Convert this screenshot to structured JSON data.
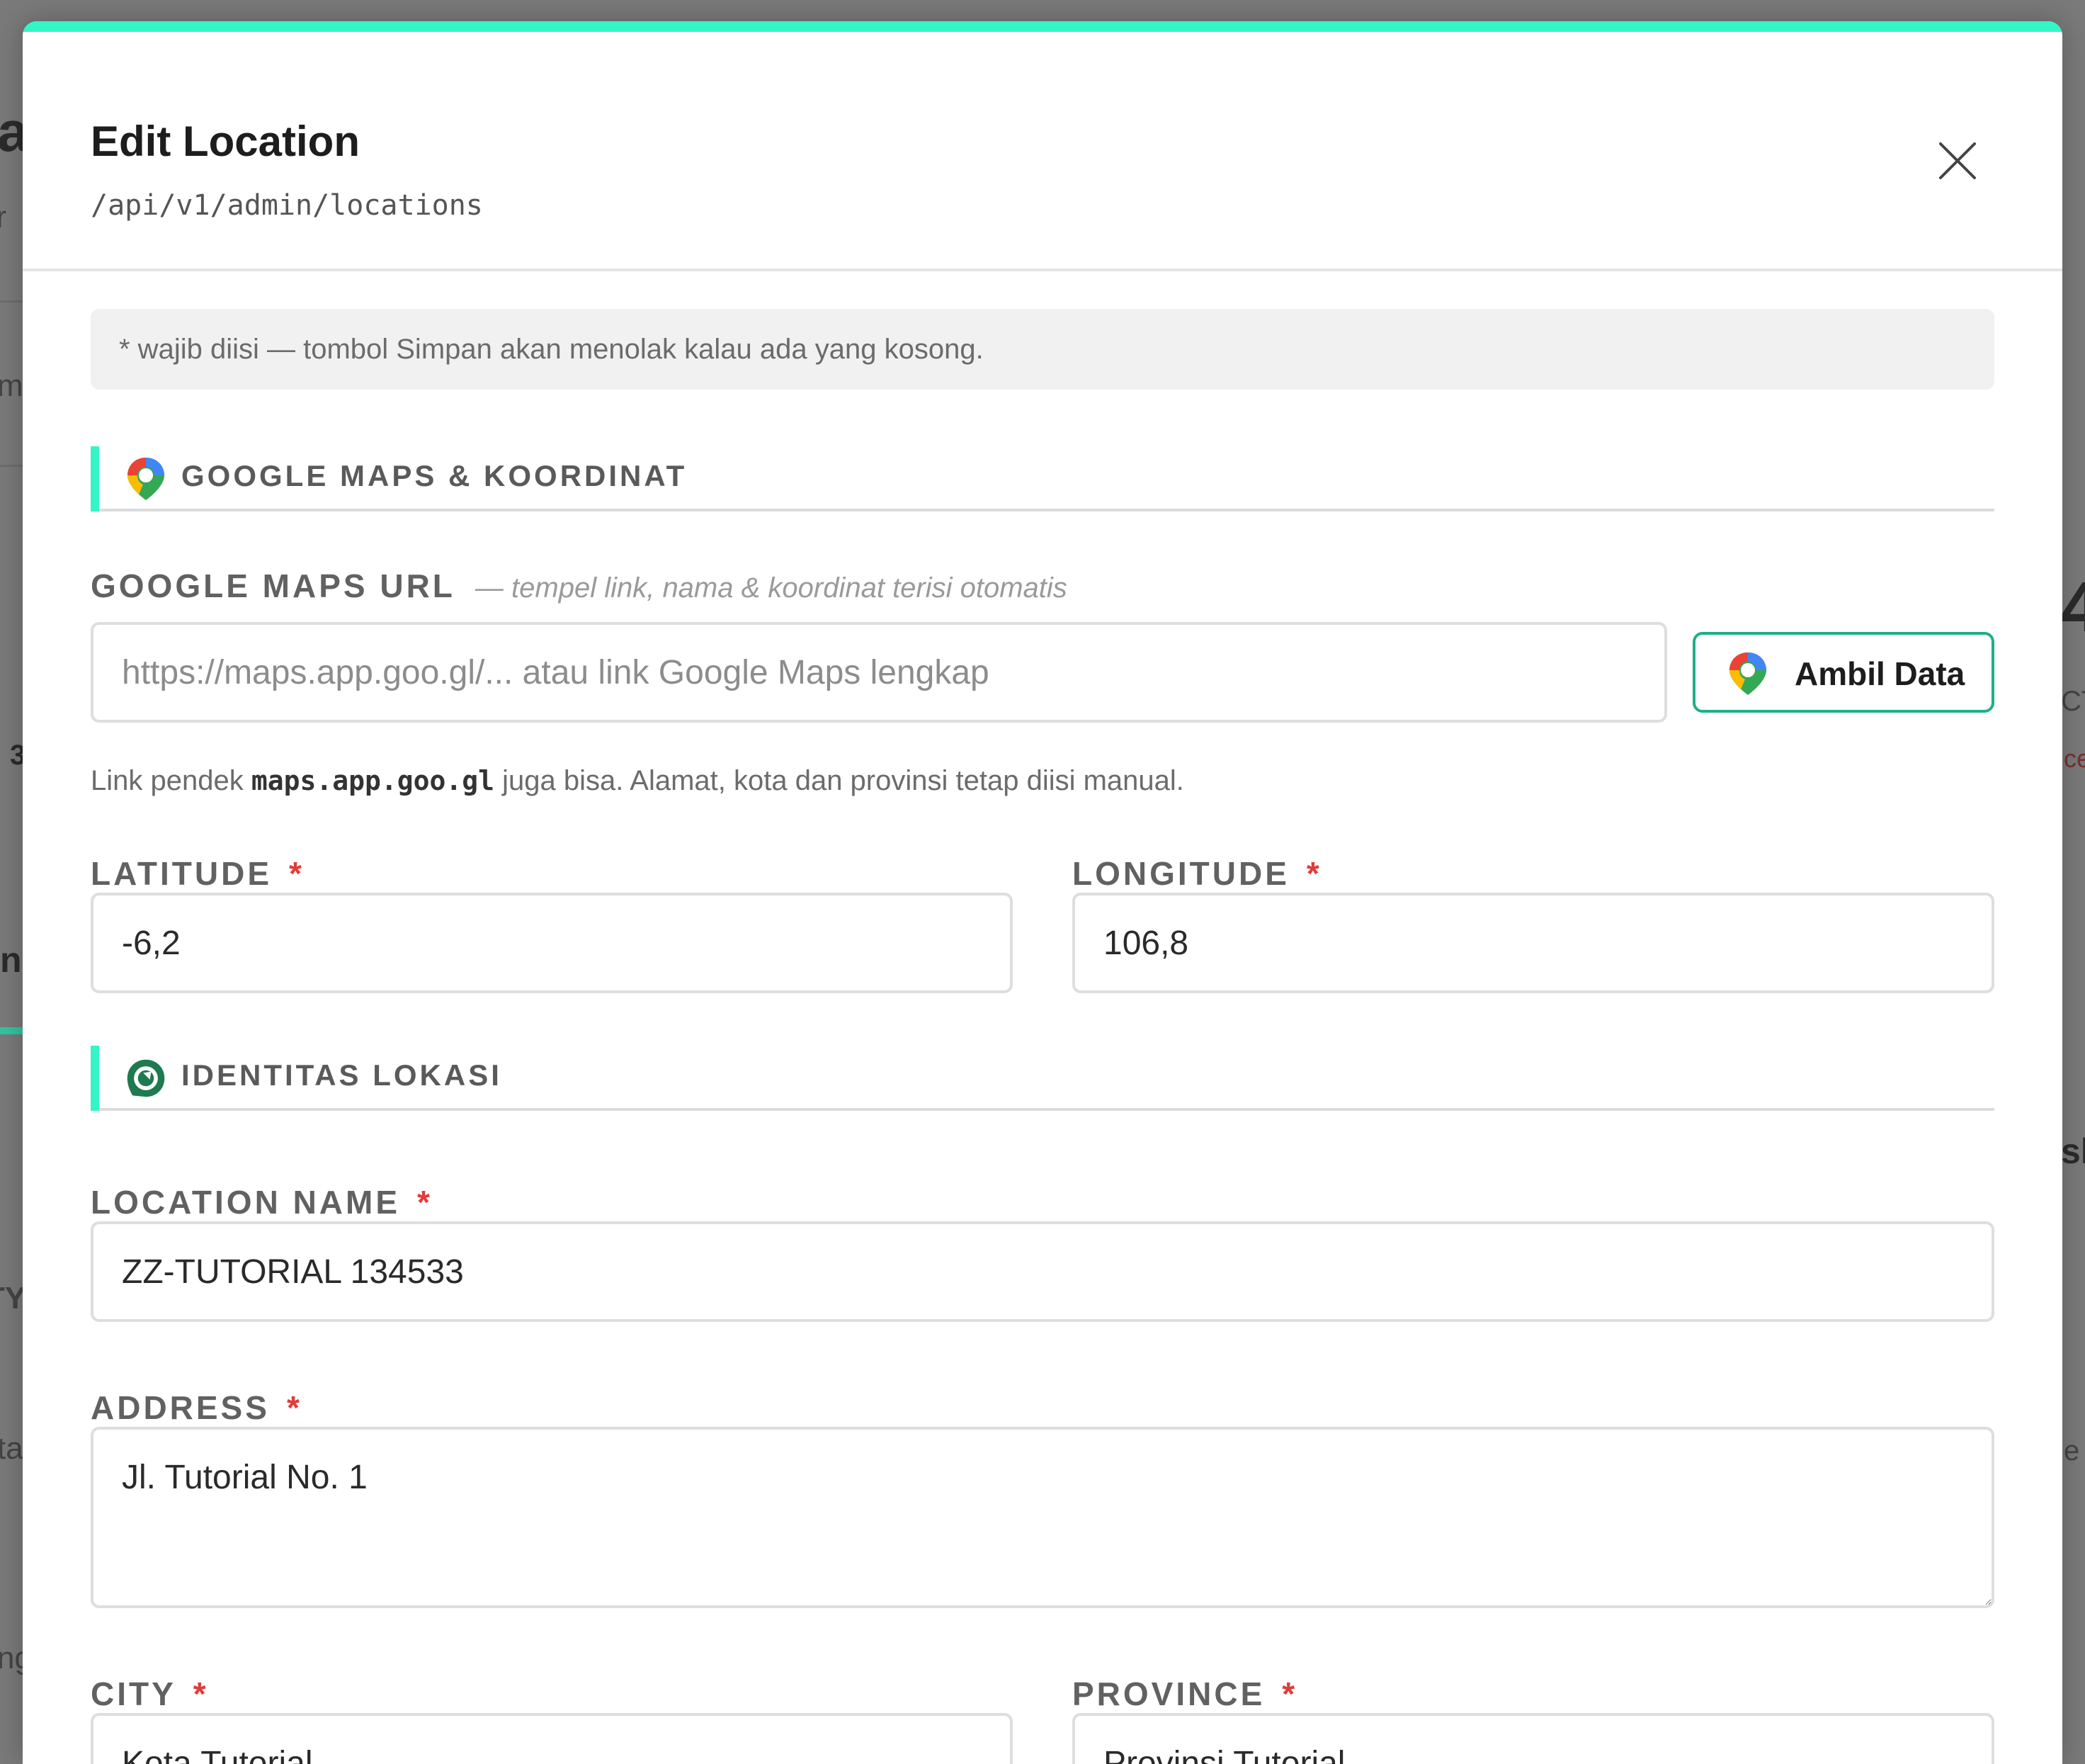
{
  "background": {
    "fragments": [
      "a",
      "or",
      "m",
      "3",
      "n",
      "TY",
      "ta",
      "ng",
      "4",
      "CT",
      "ce",
      "sh",
      "e"
    ]
  },
  "modal": {
    "title": "Edit Location",
    "endpoint": "/api/v1/admin/locations",
    "notice": "* wajib diisi — tombol Simpan akan menolak kalau ada yang kosong."
  },
  "sections": {
    "maps": {
      "title": "GOOGLE MAPS & KOORDINAT",
      "icon": "map-pin-icon"
    },
    "identity": {
      "title": "IDENTITAS LOKASI",
      "icon": "location-badge-icon"
    }
  },
  "maps_url": {
    "label": "GOOGLE MAPS URL",
    "hint": "— tempel link, nama & koordinat terisi otomatis",
    "placeholder": "https://maps.app.goo.gl/... atau link Google Maps lengkap",
    "value": "",
    "button_label": "Ambil Data",
    "helper_prefix": "Link pendek ",
    "helper_code": "maps.app.goo.gl",
    "helper_suffix": " juga bisa. Alamat, kota dan provinsi tetap diisi manual."
  },
  "fields": {
    "latitude": {
      "label": "LATITUDE",
      "required_mark": "*",
      "value": "-6,2"
    },
    "longitude": {
      "label": "LONGITUDE",
      "required_mark": "*",
      "value": "106,8"
    },
    "location_name": {
      "label": "LOCATION NAME",
      "required_mark": "*",
      "value": "ZZ-TUTORIAL 134533"
    },
    "address": {
      "label": "ADDRESS",
      "required_mark": "*",
      "value": "Jl. Tutorial No. 1"
    },
    "city": {
      "label": "CITY",
      "required_mark": "*",
      "value": "Kota Tutorial"
    },
    "province": {
      "label": "PROVINCE",
      "required_mark": "*",
      "value": "Provinsi Tutorial"
    }
  },
  "colors": {
    "accent": "#34f5c5",
    "button_border": "#1db08a",
    "required": "#e03b3b",
    "icon_green": "#1e7a4f"
  }
}
